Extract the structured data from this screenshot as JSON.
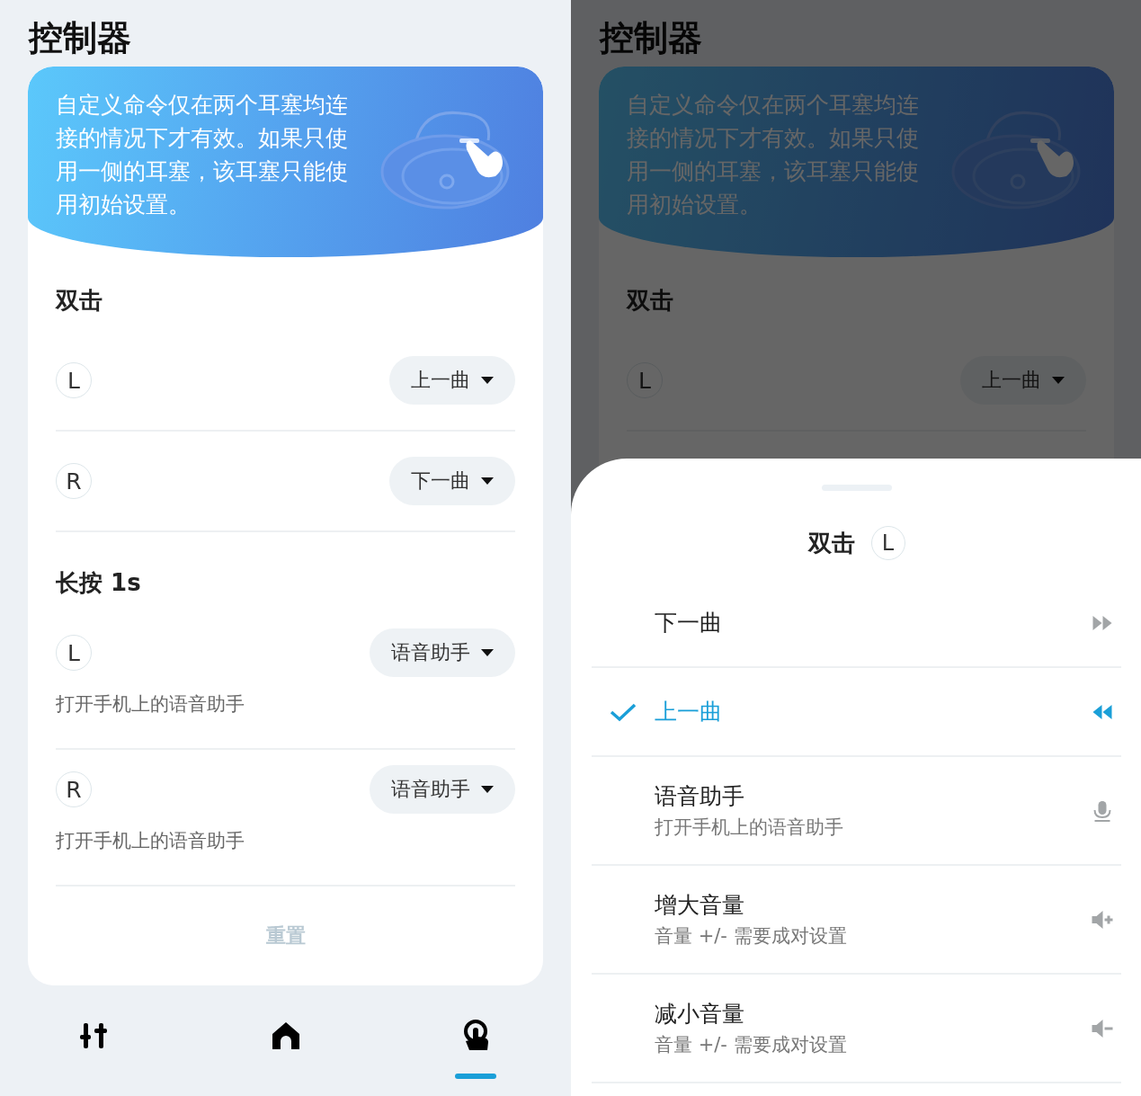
{
  "left_screen": {
    "title": "控制器",
    "notice": "自定义命令仅在两个耳塞均连接的情况下才有效。如果只使用一侧的耳塞，该耳塞只能使用初始设置。",
    "sections": [
      {
        "title": "双击",
        "rows": [
          {
            "side": "L",
            "action": "上一曲"
          },
          {
            "side": "R",
            "action": "下一曲"
          }
        ]
      },
      {
        "title": "长按 1s",
        "rows": [
          {
            "side": "L",
            "action": "语音助手",
            "description": "打开手机上的语音助手"
          },
          {
            "side": "R",
            "action": "语音助手",
            "description": "打开手机上的语音助手"
          }
        ]
      }
    ],
    "reset": {
      "label": "重置",
      "disabled": true
    },
    "nav": [
      {
        "kind": "equalizer",
        "selected": false
      },
      {
        "kind": "home",
        "selected": false
      },
      {
        "kind": "touch",
        "selected": true
      }
    ]
  },
  "right_screen": {
    "background": {
      "title": "控制器",
      "notice": "自定义命令仅在两个耳塞均连接的情况下才有效。如果只使用一侧的耳塞，该耳塞只能使用初始设置。",
      "sections": [
        {
          "title": "双击",
          "rows": [
            {
              "side": "L",
              "action": "上一曲"
            }
          ]
        }
      ]
    },
    "sheet": {
      "title": "双击",
      "side": "L",
      "options": [
        {
          "label": "下一曲",
          "kind": "next",
          "selected": false
        },
        {
          "label": "上一曲",
          "kind": "prev",
          "selected": true
        },
        {
          "label": "语音助手",
          "description": "打开手机上的语音助手",
          "kind": "mic",
          "selected": false
        },
        {
          "label": "增大音量",
          "description": "音量 +/- 需要成对设置",
          "kind": "vol_up",
          "selected": false
        },
        {
          "label": "减小音量",
          "description": "音量 +/- 需要成对设置",
          "kind": "vol_down",
          "selected": false
        }
      ]
    }
  }
}
